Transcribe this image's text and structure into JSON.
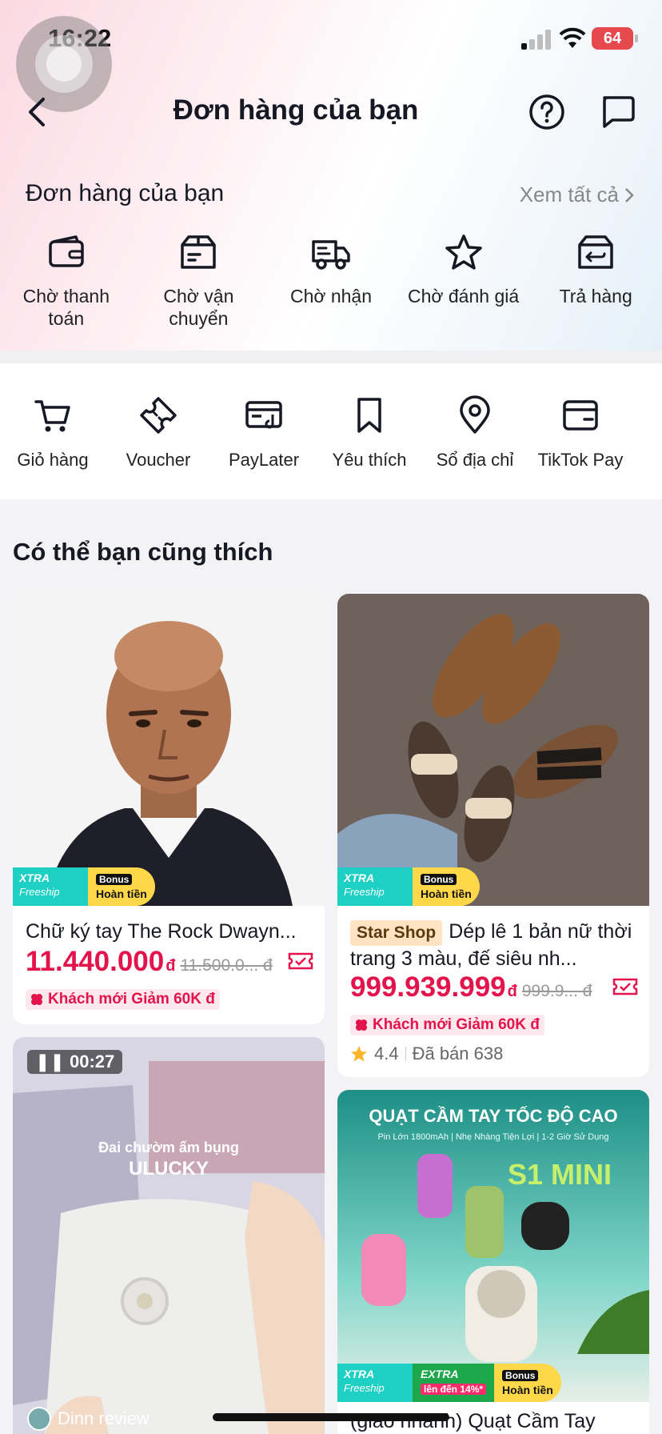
{
  "status": {
    "time": "16:22",
    "battery": "64"
  },
  "header": {
    "title": "Đơn hàng của bạn"
  },
  "orders": {
    "title": "Đơn hàng của bạn",
    "see_all": "Xem tất cả",
    "items": [
      {
        "label": "Chờ thanh toán",
        "icon": "wallet-icon"
      },
      {
        "label": "Chờ vận chuyển",
        "icon": "package-icon"
      },
      {
        "label": "Chờ nhận",
        "icon": "truck-icon"
      },
      {
        "label": "Chờ đánh giá",
        "icon": "star-icon"
      },
      {
        "label": "Trả hàng",
        "icon": "return-box-icon"
      }
    ]
  },
  "tools": [
    {
      "label": "Giỏ hàng",
      "icon": "cart-icon"
    },
    {
      "label": "Voucher",
      "icon": "voucher-icon"
    },
    {
      "label": "PayLater",
      "icon": "paylater-icon"
    },
    {
      "label": "Yêu thích",
      "icon": "bookmark-icon"
    },
    {
      "label": "Sổ địa chỉ",
      "icon": "location-pin-icon"
    },
    {
      "label": "TikTok Pay",
      "icon": "card-icon"
    }
  ],
  "recommend": {
    "title": "Có thể bạn cũng thích",
    "badges": {
      "xtra": "XTRA",
      "freeship": "Freeship",
      "bonus": "Bonus",
      "hoan_tien": "Hoàn tiền",
      "extra": "EXTRA",
      "extra_pill": "lên đến 14%*"
    },
    "products": [
      {
        "title": "Chữ ký tay The Rock Dwayn...",
        "price": "11.440.000",
        "currency": "đ",
        "old_price": "11.500.0... đ",
        "promo": "Khách mới  Giảm 60K đ"
      },
      {
        "shop_tag": "Star Shop",
        "title": "Dép lê 1 bản nữ thời trang 3 màu, đế siêu nh...",
        "price": "999.939.999",
        "currency": "đ",
        "old_price": "999.9... đ",
        "promo": "Khách mới  Giảm 60K đ",
        "rating": "4.4",
        "sold": "Đã bán 638"
      },
      {
        "video_time": "00:27",
        "overlay_line1": "Đai chườm ấm bụng",
        "overlay_line2": "ULUCKY",
        "reviewer": "Dinn review"
      },
      {
        "banner_title": "QUẠT CẦM TAY TỐC ĐỘ CAO",
        "banner_sub": "Pin Lớn 1800mAh  |  Nhẹ Nhàng Tiện Lợi  |  1-2 Giờ Sử Dụng",
        "banner_model": "S1 MINI",
        "title": "(giao nhanh) Quạt Cầm Tay"
      }
    ]
  }
}
